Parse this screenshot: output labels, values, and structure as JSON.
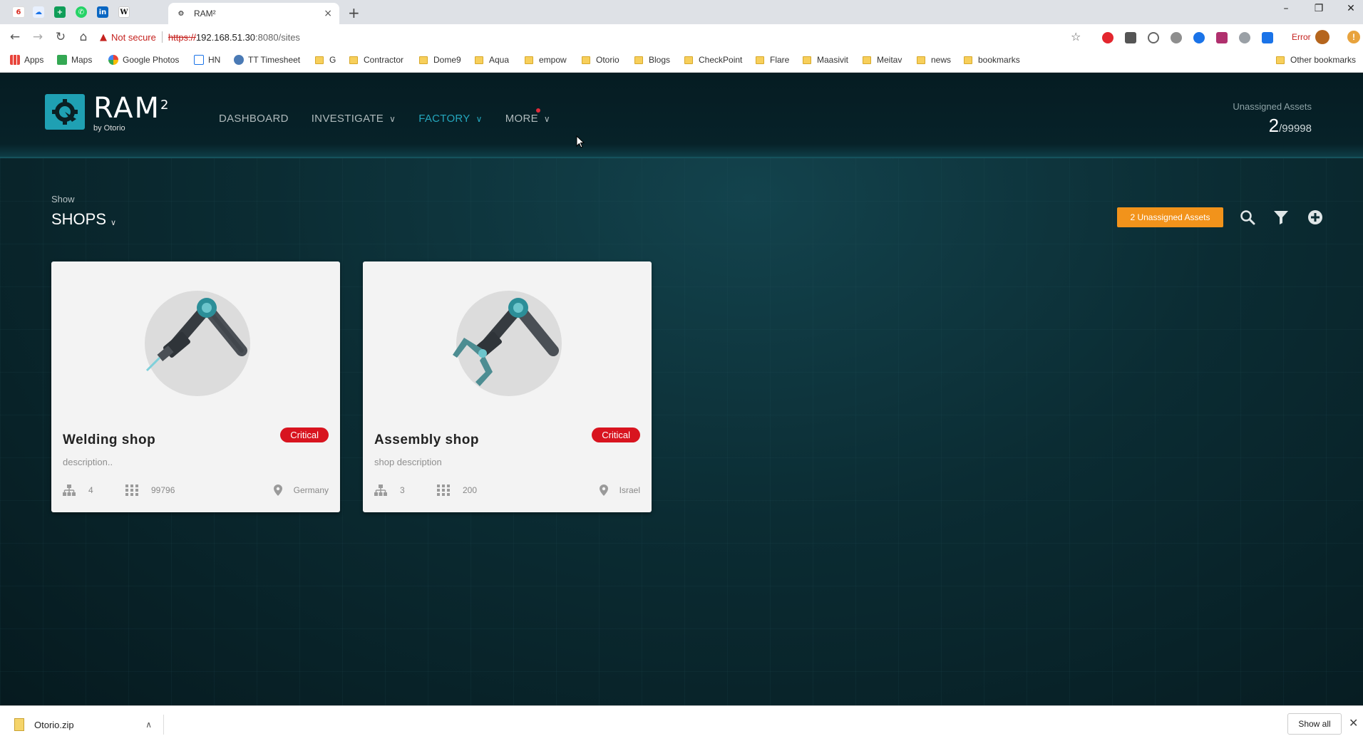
{
  "browser": {
    "tab_title": "RAM²",
    "tab_close": "×",
    "new_tab": "+",
    "window_controls": {
      "minimize": "–",
      "restore": "❐",
      "close": "✕"
    },
    "security_label": "Not secure",
    "url_scheme": "https://",
    "url_host": "192.168.51.30",
    "url_rest": ":8080/sites",
    "profile_status": "Error",
    "gmail_count": "6",
    "bookmarks": [
      "Apps",
      "Maps",
      "Google Photos",
      "HN",
      "TT Timesheet",
      "G",
      "Contractor",
      "Dome9",
      "Aqua",
      "empow",
      "Otorio",
      "Blogs",
      "CheckPoint",
      "Flare",
      "Maasivit",
      "Meitav",
      "news",
      "bookmarks"
    ],
    "other_bookmarks": "Other bookmarks"
  },
  "app": {
    "logo_text": "RAM",
    "logo_sup": "2",
    "logo_by": "by Otorio",
    "nav": [
      {
        "label": "DASHBOARD"
      },
      {
        "label": "INVESTIGATE"
      },
      {
        "label": "FACTORY"
      },
      {
        "label": "MORE"
      }
    ],
    "unassigned_label": "Unassigned Assets",
    "unassigned_count": "2",
    "unassigned_total": "/99998"
  },
  "toolbar": {
    "show_label": "Show",
    "view_select": "SHOPS",
    "unassigned_button": "2 Unassigned Assets"
  },
  "shops": [
    {
      "name": "Welding shop",
      "status": "Critical",
      "description": "description..",
      "hierarchy_count": "4",
      "asset_count": "99796",
      "location": "Germany"
    },
    {
      "name": "Assembly shop",
      "status": "Critical",
      "description": "shop description",
      "hierarchy_count": "3",
      "asset_count": "200",
      "location": "Israel"
    }
  ],
  "downloads": {
    "file_name": "Otorio.zip",
    "show_all": "Show all"
  },
  "colors": {
    "accent": "#24a6bd",
    "warning_button": "#f2931b",
    "critical": "#d8141f",
    "header_bg": "#051c22"
  }
}
